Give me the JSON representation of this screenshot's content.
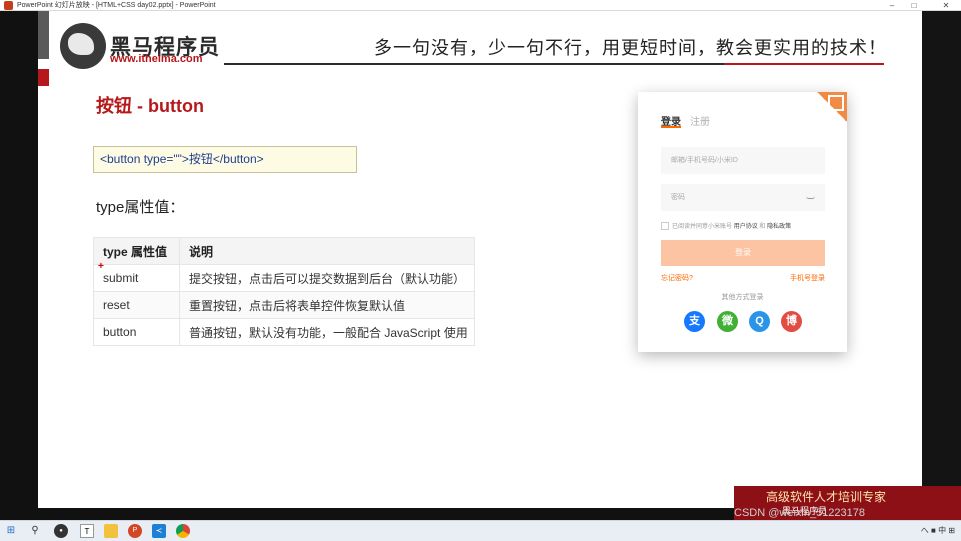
{
  "window": {
    "title": "PowerPoint 幻灯片放映 - [HTML+CSS day02.pptx] - PowerPoint",
    "minimize": "–",
    "maximize": "□",
    "close": "✕"
  },
  "header": {
    "brand_cn": "黑马程序员",
    "brand_url": "www.itheima.com",
    "slogan": "多一句没有，少一句不行，用更短时间，教会更实用的技术！"
  },
  "slide": {
    "title": "按钮 - button",
    "code": "<button type=\"\">按钮</button>",
    "type_label": "type属性值：",
    "table": {
      "headers": [
        "type 属性值",
        "说明"
      ],
      "rows": [
        [
          "submit",
          "提交按钮，点击后可以提交数据到后台（默认功能）"
        ],
        [
          "reset",
          "重置按钮，点击后将表单控件恢复默认值"
        ],
        [
          "button",
          "普通按钮，默认没有功能，一般配合 JavaScript 使用"
        ]
      ]
    }
  },
  "login_card": {
    "tab_login": "登录",
    "tab_register": "注册",
    "account_placeholder": "邮箱/手机号码/小米ID",
    "password_placeholder": "密码",
    "agree_prefix": "已阅读并同意小米账号",
    "agree_terms": "用户协议",
    "agree_and": "和",
    "agree_privacy": "隐私政策",
    "login_button": "登录",
    "forgot": "忘记密码?",
    "phone_login": "手机号登录",
    "other_ways": "其他方式登录",
    "social": [
      "支",
      "微",
      "Q",
      "博"
    ]
  },
  "banner": {
    "text": "高级软件人才培训专家",
    "sub": "黑马程序员",
    "watermark": "CSDN @weixin_51223178"
  },
  "taskbar": {
    "tray_text": "へ ■ 中 ⊞"
  },
  "colors": {
    "brand_red": "#b5191b",
    "mi_orange": "#ff6700"
  }
}
